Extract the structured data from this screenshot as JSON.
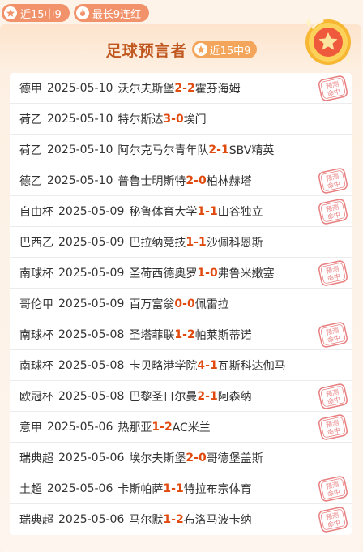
{
  "badges": {
    "streak_recent": "近15中9",
    "streak_longest": "最长9连红"
  },
  "header": {
    "title": "足球预言者",
    "badge": "近15中9"
  },
  "stamp_text": [
    "预测",
    "命中"
  ],
  "colors": {
    "accent": "#f2926b",
    "score": "#e14a0e",
    "title": "#c0571f",
    "stamp": "#e87f80"
  },
  "matches": [
    {
      "league": "德甲",
      "date": "2025-05-10",
      "home": "沃尔夫斯堡",
      "hs": "2",
      "as": "2",
      "away": "霍芬海姆",
      "hit": true
    },
    {
      "league": "荷乙",
      "date": "2025-05-10",
      "home": "特尔斯达",
      "hs": "3",
      "as": "0",
      "away": "埃门",
      "hit": false
    },
    {
      "league": "荷乙",
      "date": "2025-05-10",
      "home": "阿尔克马尔青年队",
      "hs": "2",
      "as": "1",
      "away": "SBV精英",
      "hit": false
    },
    {
      "league": "德乙",
      "date": "2025-05-10",
      "home": "普鲁士明斯特",
      "hs": "2",
      "as": "0",
      "away": "柏林赫塔",
      "hit": true
    },
    {
      "league": "自由杯",
      "date": "2025-05-09",
      "home": "秘鲁体育大学",
      "hs": "1",
      "as": "1",
      "away": "山谷独立",
      "hit": true
    },
    {
      "league": "巴西乙",
      "date": "2025-05-09",
      "home": "巴拉纳竞技",
      "hs": "1",
      "as": "1",
      "away": "沙佩科恩斯",
      "hit": false
    },
    {
      "league": "南球杯",
      "date": "2025-05-09",
      "home": "圣荷西德奥罗",
      "hs": "1",
      "as": "0",
      "away": "弗鲁米嫩塞",
      "hit": true
    },
    {
      "league": "哥伦甲",
      "date": "2025-05-09",
      "home": "百万富翁",
      "hs": "0",
      "as": "0",
      "away": "佩雷拉",
      "hit": false
    },
    {
      "league": "南球杯",
      "date": "2025-05-08",
      "home": "圣塔菲联",
      "hs": "1",
      "as": "2",
      "away": "帕莱斯蒂诺",
      "hit": true
    },
    {
      "league": "南球杯",
      "date": "2025-05-08",
      "home": "卡贝略港学院",
      "hs": "4",
      "as": "1",
      "away": "瓦斯科达伽马",
      "hit": false
    },
    {
      "league": "欧冠杯",
      "date": "2025-05-08",
      "home": "巴黎圣日尔曼",
      "hs": "2",
      "as": "1",
      "away": "阿森纳",
      "hit": true
    },
    {
      "league": "意甲",
      "date": "2025-05-06",
      "home": "热那亚",
      "hs": "1",
      "as": "2",
      "away": "AC米兰",
      "hit": true
    },
    {
      "league": "瑞典超",
      "date": "2025-05-06",
      "home": "埃尔夫斯堡",
      "hs": "2",
      "as": "0",
      "away": "哥德堡盖斯",
      "hit": false
    },
    {
      "league": "土超",
      "date": "2025-05-06",
      "home": "卡斯帕萨",
      "hs": "1",
      "as": "1",
      "away": "特拉布宗体育",
      "hit": true
    },
    {
      "league": "瑞典超",
      "date": "2025-05-06",
      "home": "马尔默",
      "hs": "1",
      "as": "2",
      "away": "布洛马波卡纳",
      "hit": true
    }
  ]
}
